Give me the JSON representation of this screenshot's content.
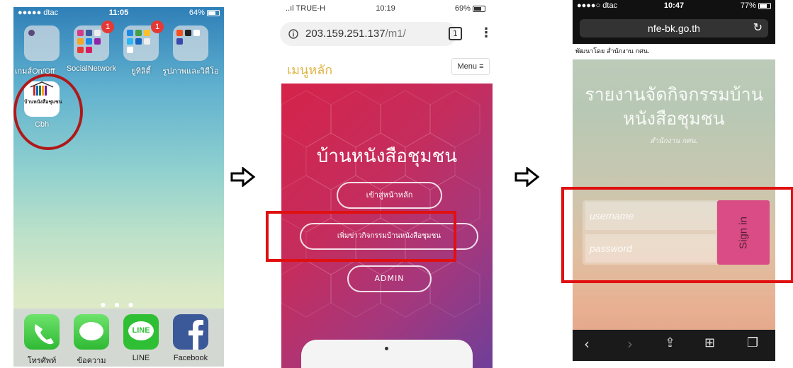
{
  "screen1": {
    "status": {
      "carrier": "●●●●● dtac",
      "time": "11:05",
      "battery": "64%"
    },
    "folders": [
      {
        "label": "เกมส์On/Off"
      },
      {
        "label": "SocialNetwork",
        "badge": ""
      },
      {
        "label": "ยูทิลิตี้",
        "badge": "1"
      },
      {
        "label": "รูปภาพและวิดีโอ"
      }
    ],
    "social_badge": "1",
    "cbh_app": {
      "label": "Cbh",
      "icon_text": "บ้านหนังสือชุมชน"
    },
    "dock": [
      "โทรศัพท์",
      "ข้อความ",
      "LINE",
      "Facebook"
    ],
    "line_icon_text": "LINE",
    "colors": {
      "highlight": "#b01818"
    }
  },
  "screen2": {
    "status": {
      "carrier": "..ıl TRUE-H",
      "time": "10:19",
      "battery": "69%"
    },
    "url_host": "203.159.251.137",
    "url_path": "/m1/",
    "tab_count": "1",
    "menu_title": "เมนูหลัก",
    "menu_button": "Menu ≡",
    "hero_title": "บ้านหนังสือชุมชน",
    "buttons": [
      "เข้าสู่หน้าหลัก",
      "เพิ่มข่าวกิจกรรมบ้านหนังสือชุมชน",
      "ADMIN"
    ],
    "colors": {
      "gradient_start": "#d5234a",
      "gradient_end": "#6e3f99",
      "menu_title": "#e1b646"
    }
  },
  "screen3": {
    "status": {
      "carrier": "●●●●○ dtac",
      "time": "10:47",
      "battery": "77%"
    },
    "url": "nfe-bk.go.th",
    "developed_by": "พัฒนาโดย สำนักงาน กศน.",
    "title_line1": "รายงานจัดกิจกรรมบ้าน",
    "title_line2": "หนังสือชุมชน",
    "subtitle": "สำนักงาน กศน.",
    "username_placeholder": "username",
    "password_placeholder": "password",
    "signin_label": "Sign in",
    "colors": {
      "signin": "#d94c86",
      "highlight": "#e01010"
    }
  }
}
